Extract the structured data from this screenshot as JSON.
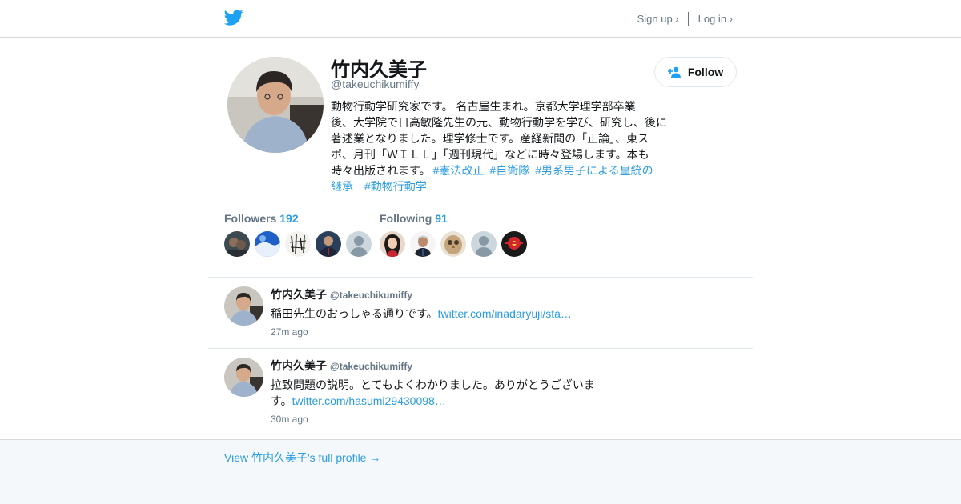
{
  "colors": {
    "brand_blue": "#1da1f2",
    "link_blue": "#2b9ce0",
    "muted_gray": "#657786"
  },
  "header": {
    "logo_icon": "twitter-bird-icon",
    "signup": "Sign up ›",
    "login": "Log in ›"
  },
  "profile": {
    "name": "竹内久美子",
    "handle": "@takeuchikumiffy",
    "follow_label": "Follow",
    "follow_icon": "add-person-icon",
    "bio_lines": [
      "動物行動学研究家です。 名古屋生まれ。京都大学理学部卒業",
      "後、大学院で日高敏隆先生の元、動物行動学を学び、研究し、後に",
      "著述業となりました。理学修士です。産経新聞の「正論」、東ス",
      "ポ、月刊「ＷＩＬＬ」「週刊現代」などに時々登場します。本も"
    ],
    "bio_last_line": "時々出版されます。",
    "hashtags": [
      "#憲法改正",
      "#自衛隊",
      "#男系男子による皇統の",
      "継承",
      "#動物行動学"
    ],
    "followers_label": "Followers",
    "followers_count": "192",
    "following_label": "Following",
    "following_count": "91"
  },
  "tweets": [
    {
      "name": "竹内久美子",
      "handle": "@takeuchikumiffy",
      "text": "稲田先生のおっしゃる通りです。",
      "link": "twitter.com/inadaryuji/sta…",
      "time": "27m ago"
    },
    {
      "name": "竹内久美子",
      "handle": "@takeuchikumiffy",
      "text_line1": "拉致問題の説明。とてもよくわかりました。ありがとうございま",
      "text_line2": "す。",
      "link": "twitter.com/hasumi29430098…",
      "time": "30m ago"
    }
  ],
  "footer": {
    "view_full": "View 竹内久美子's full profile →"
  }
}
